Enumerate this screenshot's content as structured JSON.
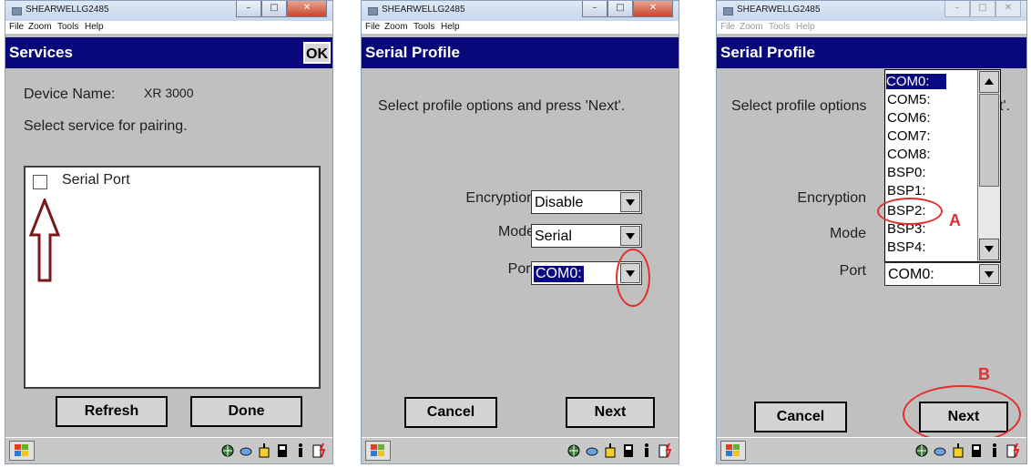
{
  "panel1": {
    "window_title": "SHEARWELLG2485",
    "menu": [
      "File",
      "Zoom",
      "Tools",
      "Help"
    ],
    "header_title": "Services",
    "ok_label": "OK",
    "device_name_label": "Device Name:",
    "device_name_value": "XR 3000",
    "instruction": "Select service for pairing.",
    "service_item": "Serial Port",
    "refresh_label": "Refresh",
    "done_label": "Done"
  },
  "panel2": {
    "window_title": "SHEARWELLG2485",
    "menu": [
      "File",
      "Zoom",
      "Tools",
      "Help"
    ],
    "header_title": "Serial Profile",
    "instruction": "Select profile options and press 'Next'.",
    "encryption_label": "Encryption",
    "encryption_value": "Disable",
    "mode_label": "Mode",
    "mode_value": "Serial",
    "port_label": "Port",
    "port_value": "COM0:",
    "cancel_label": "Cancel",
    "next_label": "Next"
  },
  "panel3": {
    "window_title": "SHEARWELLG2485",
    "menu": [
      "File",
      "Zoom",
      "Tools",
      "Help"
    ],
    "header_title": "Serial Profile",
    "instruction_left": "Select profile options",
    "instruction_right": "t'.",
    "encryption_label": "Encryption",
    "mode_label": "Mode",
    "port_label": "Port",
    "port_value": "COM0:",
    "dropdown_items": [
      "COM0:",
      "COM5:",
      "COM6:",
      "COM7:",
      "COM8:",
      "BSP0:",
      "BSP1:",
      "BSP2:",
      "BSP3:",
      "BSP4:"
    ],
    "annotation_a": "A",
    "annotation_b": "B",
    "cancel_label": "Cancel",
    "next_label": "Next"
  },
  "colors": {
    "header_bg": "#08087a",
    "annotation": "#e23030",
    "arrow": "#7a1818"
  },
  "tray_icons": [
    "network-icon",
    "connection-icon",
    "volume-icon",
    "card-icon",
    "info-icon",
    "battery-icon"
  ]
}
